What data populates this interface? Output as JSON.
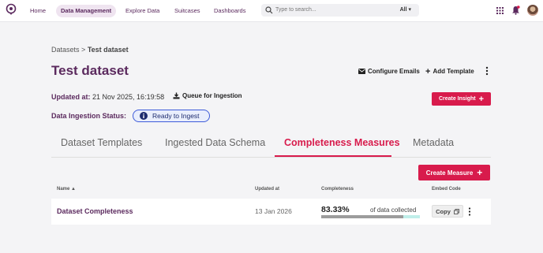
{
  "nav": {
    "items": [
      {
        "label": "Home",
        "active": false
      },
      {
        "label": "Data Management",
        "active": true
      },
      {
        "label": "Explore Data",
        "active": false
      },
      {
        "label": "Suitcases",
        "active": false
      },
      {
        "label": "Dashboards",
        "active": false
      }
    ],
    "search_placeholder": "Type to search...",
    "search_scope": "All",
    "icons": [
      "logo-icon",
      "search-icon",
      "apps-grid-icon",
      "notification-bell-icon",
      "avatar"
    ]
  },
  "breadcrumb": {
    "parent": "Datasets",
    "separator": ">",
    "current": "Test dataset"
  },
  "page": {
    "title": "Test dataset",
    "actions": {
      "configure_emails": "Configure Emails",
      "add_template": "Add Template"
    },
    "updated_label": "Updated at:",
    "updated_value": "21 Nov 2025, 16:19:58",
    "queue_label": "Queue for Ingestion",
    "create_insight": "Create Insight",
    "status_label": "Data Ingestion Status:",
    "status_value": "Ready to Ingest"
  },
  "tabs": [
    {
      "label": "Dataset Templates",
      "active": false
    },
    {
      "label": "Ingested Data Schema",
      "active": false
    },
    {
      "label": "Completeness Measures",
      "active": true
    },
    {
      "label": "Metadata",
      "active": false
    }
  ],
  "create_measure": "Create Measure",
  "table": {
    "headers": {
      "name": "Name",
      "updated": "Updated at",
      "completeness": "Completeness",
      "embed": "Embed Code"
    },
    "rows": [
      {
        "name": "Dataset Completeness",
        "updated": "13 Jan 2026",
        "percent": "83.33%",
        "percent_value": 83.33,
        "suffix": "of data collected",
        "copy": "Copy"
      }
    ]
  },
  "colors": {
    "brand": "#5b2a5e",
    "accent": "#d81b4c",
    "status_border": "#3d5bd9",
    "bar_track": "#bfeee9"
  }
}
